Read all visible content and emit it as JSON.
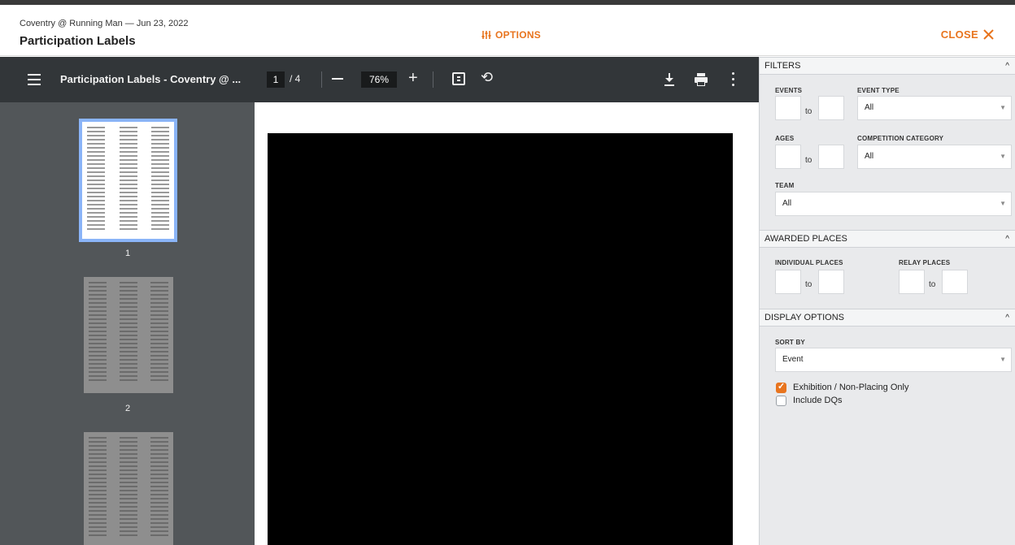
{
  "header": {
    "subtitle": "Coventry @ Running Man — Jun 23, 2022",
    "title": "Participation Labels",
    "options_label": "OPTIONS",
    "close_label": "CLOSE",
    "accent_color": "#e8741e"
  },
  "pdf_viewer": {
    "doc_title": "Participation Labels - Coventry @ ...",
    "current_page": "1",
    "page_total": "/ 4",
    "zoom": "76%",
    "thumbnails": [
      {
        "label": "1",
        "selected": true
      },
      {
        "label": "2",
        "selected": false
      },
      {
        "label": "",
        "selected": false
      }
    ],
    "icons": [
      "menu-icon",
      "zoom-out-icon",
      "zoom-in-icon",
      "fit-page-icon",
      "rotate-icon",
      "download-icon",
      "print-icon",
      "more-icon"
    ]
  },
  "filters": {
    "section_title": "FILTERS",
    "events_label": "EVENTS",
    "events_from": "",
    "events_to": "",
    "event_type_label": "EVENT TYPE",
    "event_type_value": "All",
    "ages_label": "AGES",
    "ages_from": "",
    "ages_to": "",
    "competition_category_label": "COMPETITION CATEGORY",
    "competition_category_value": "All",
    "team_label": "TEAM",
    "team_value": "All",
    "to_label": "to"
  },
  "awarded_places": {
    "section_title": "AWARDED PLACES",
    "individual_label": "INDIVIDUAL PLACES",
    "relay_label": "RELAY PLACES",
    "to_label": "to"
  },
  "display_options": {
    "section_title": "DISPLAY OPTIONS",
    "sort_by_label": "SORT BY",
    "sort_by_value": "Event",
    "exhibition_label": "Exhibition / Non-Placing Only",
    "exhibition_checked": true,
    "include_dqs_label": "Include DQs",
    "include_dqs_checked": false
  }
}
